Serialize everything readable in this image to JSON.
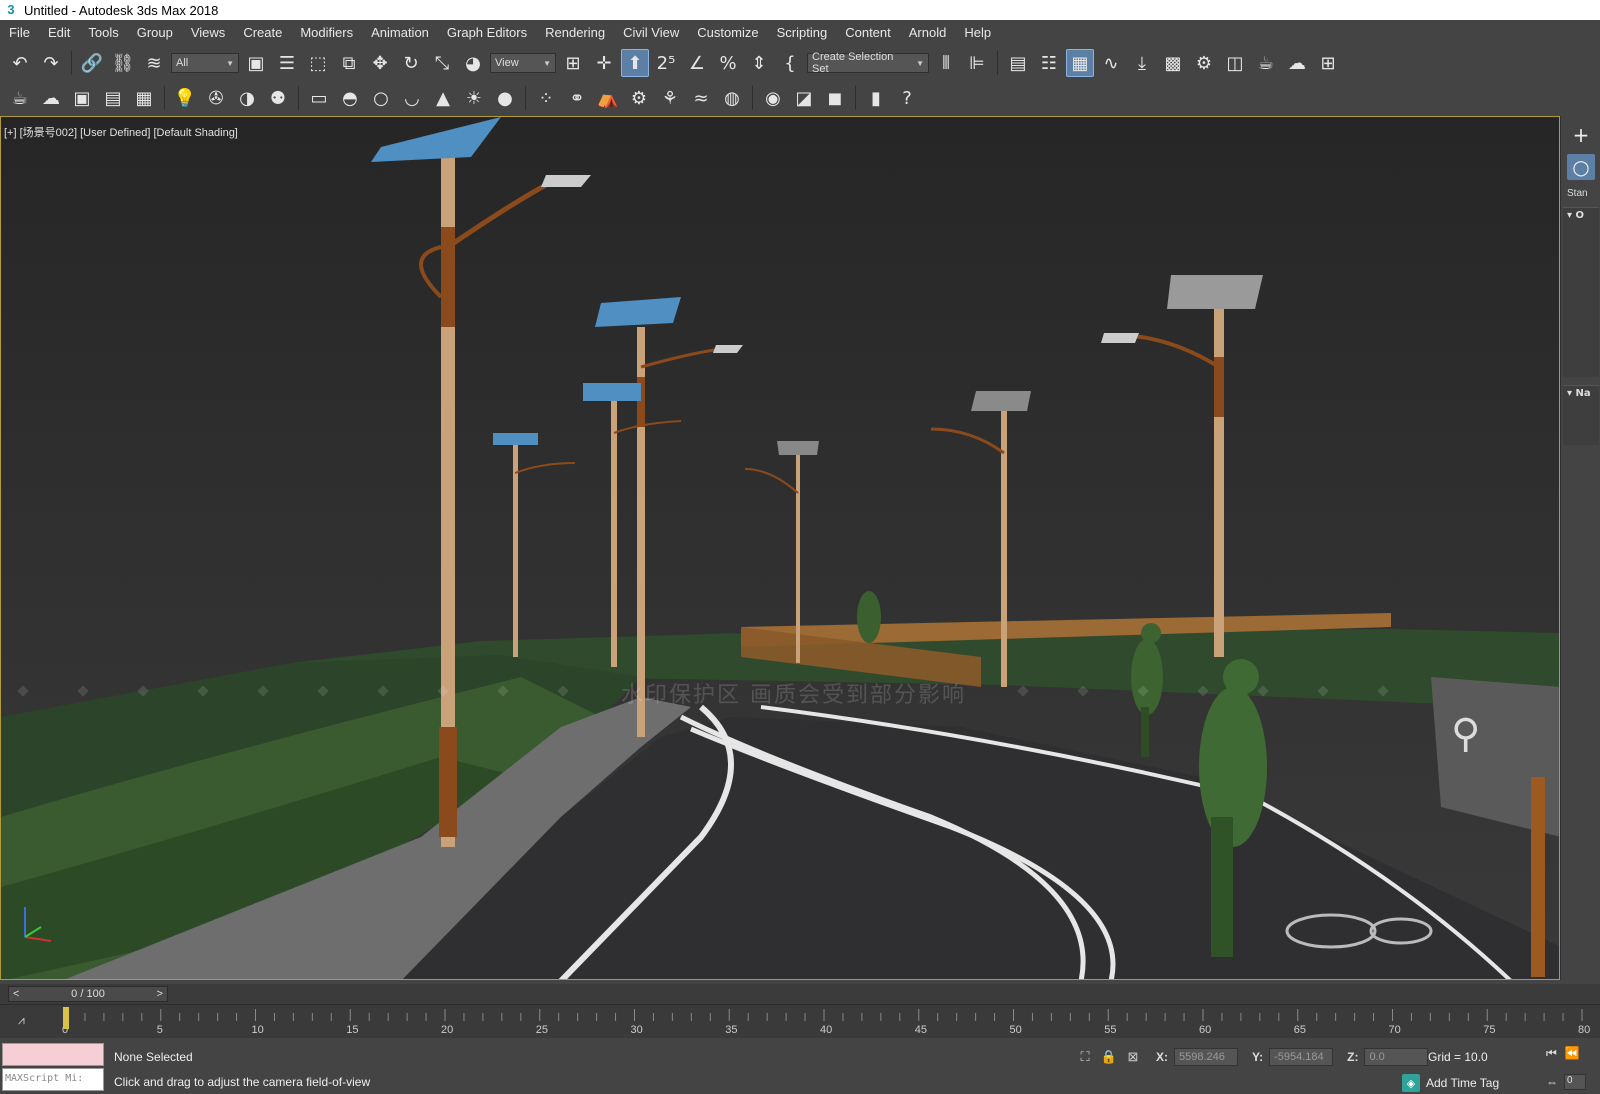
{
  "window": {
    "title": "Untitled - Autodesk 3ds Max 2018",
    "icon": "3"
  },
  "menu": {
    "items": [
      "File",
      "Edit",
      "Tools",
      "Group",
      "Views",
      "Create",
      "Modifiers",
      "Animation",
      "Graph Editors",
      "Rendering",
      "Civil View",
      "Customize",
      "Scripting",
      "Content",
      "Arnold",
      "Help"
    ]
  },
  "toolbar": {
    "selection_filter": "All",
    "ref_coord": "View",
    "named_selection": "Create Selection Set"
  },
  "viewport": {
    "label": "[+] [场景号002] [User Defined] [Default Shading]",
    "watermark": "水印保护区  画质会受到部分影响",
    "colors": {
      "sky": "#2b2b2b",
      "grass": "#2f4a2c",
      "road": "#2e2e30",
      "pole": "#c9a27a",
      "rust": "#8a4a1c",
      "panel": "#4f8fc2"
    }
  },
  "command_panel": {
    "category_label": "Stan",
    "rollout1": "O",
    "rollout2": "Na"
  },
  "timeline": {
    "slider_label": "0 / 100",
    "prev": "<",
    "next": ">",
    "ticks": [
      "0",
      "5",
      "10",
      "15",
      "20",
      "25",
      "30",
      "35",
      "40",
      "45",
      "50",
      "55",
      "60",
      "65",
      "70",
      "75",
      "80"
    ]
  },
  "status": {
    "selection": "None Selected",
    "prompt": "Click and drag to adjust the camera field-of-view",
    "maxscript_placeholder": "MAXScript Mi:",
    "x_label": "X:",
    "x_value": "5598.246",
    "y_label": "Y:",
    "y_value": "-5954.184",
    "z_label": "Z:",
    "z_value": "0.0",
    "grid": "Grid = 10.0",
    "add_time_tag": "Add Time Tag",
    "frame_value": "0"
  }
}
